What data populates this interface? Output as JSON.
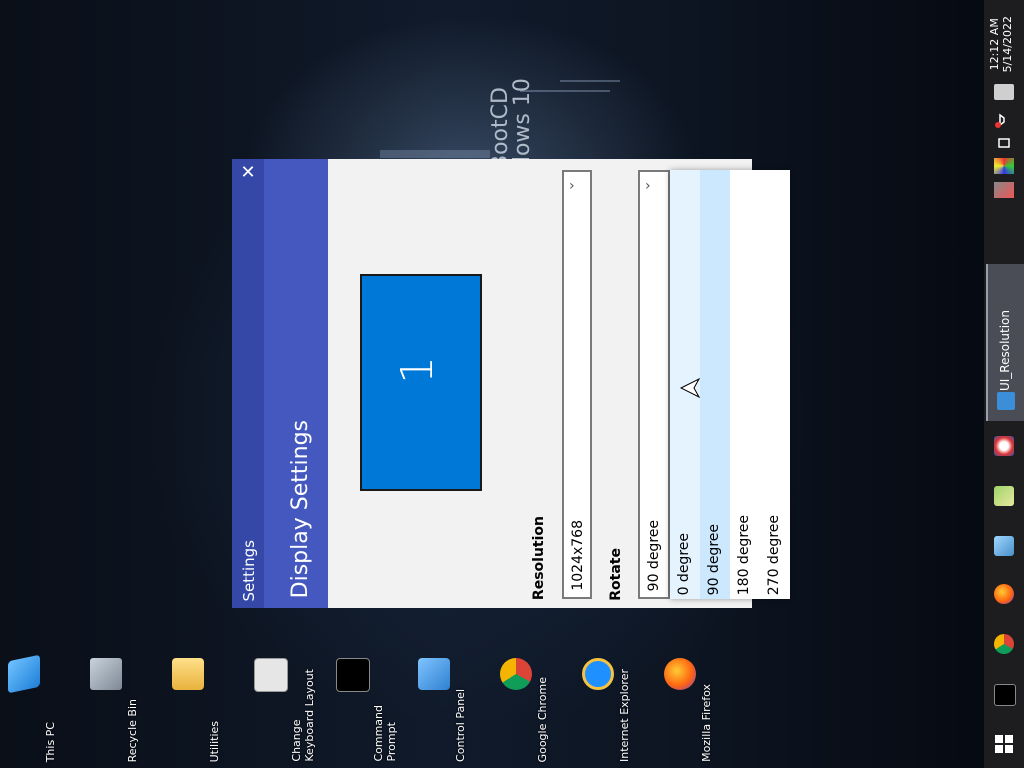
{
  "desktop": {
    "wallpaper_text": "BootCD\ndows 10",
    "icons": [
      {
        "label": "This PC"
      },
      {
        "label": "Recycle Bin"
      },
      {
        "label": "Utilities"
      },
      {
        "label": "Change\nKeyboard Layout"
      },
      {
        "label": "Command\nPrompt"
      },
      {
        "label": "Control Panel"
      },
      {
        "label": "Google Chrome"
      },
      {
        "label": "Internet Explorer"
      },
      {
        "label": "Mozilla Firefox"
      }
    ]
  },
  "window": {
    "caption": "Settings",
    "title": "Display Settings",
    "close_glyph": "✕",
    "monitor_number": "1",
    "resolution": {
      "label": "Resolution",
      "value": "1024x768"
    },
    "rotate": {
      "label": "Rotate",
      "value": "90 degree",
      "options": [
        "0 degree",
        "90 degree",
        "180 degree",
        "270 degree"
      ],
      "hovered_index": 0,
      "selected_index": 1
    },
    "colors": {
      "title_bar": "#4558c0",
      "title_dark": "#3548a8",
      "monitor": "#0078d7",
      "selected_option": "#cce8ff",
      "hover_option": "#e5f3ff"
    }
  },
  "taskbar": {
    "time": "12:12 AM",
    "date": "5/14/2022",
    "active_app": "UI_Resolution",
    "pinned": [
      "paint-icon",
      "notepad-icon",
      "wallpaper-icon",
      "firefox-icon",
      "chrome-icon",
      "cmd-icon",
      "start-icon"
    ],
    "tray": [
      "keyboard-icon",
      "volume-muted-icon",
      "network-icon",
      "color-icon",
      "display-icon"
    ]
  }
}
